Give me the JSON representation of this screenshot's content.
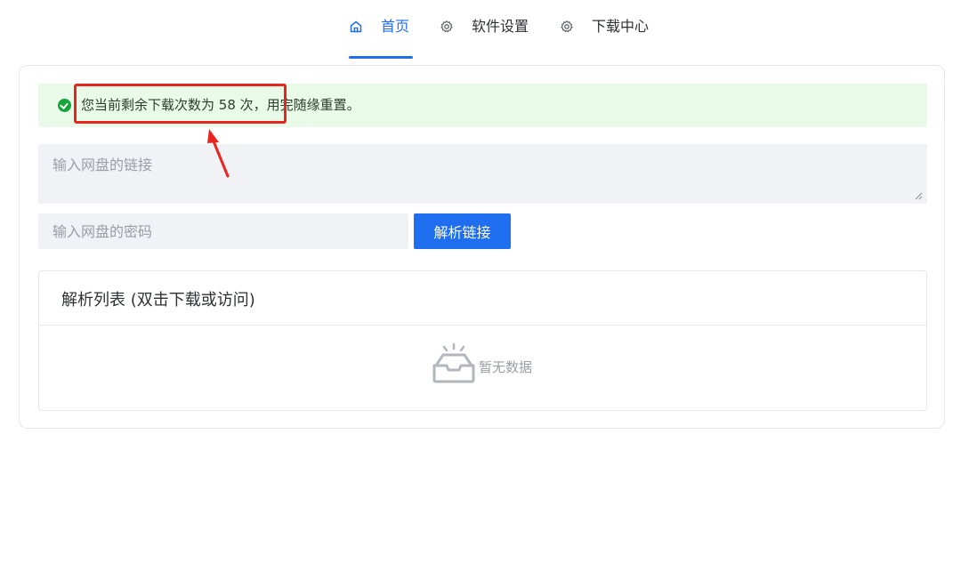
{
  "nav": {
    "items": [
      {
        "label": "首页",
        "icon": "home-icon",
        "active": true
      },
      {
        "label": "软件设置",
        "icon": "gear-icon",
        "active": false
      },
      {
        "label": "下载中心",
        "icon": "gear-icon",
        "active": false
      }
    ]
  },
  "alert": {
    "message": "您当前剩余下载次数为 58 次，用完随缘重置。",
    "type": "success"
  },
  "form": {
    "link_placeholder": "输入网盘的链接",
    "link_value": "",
    "password_placeholder": "输入网盘的密码",
    "password_value": "",
    "parse_button_label": "解析链接"
  },
  "list": {
    "title": "解析列表 (双击下载或访问)",
    "empty_text": "暂无数据"
  },
  "colors": {
    "accent": "#1f6ef0",
    "success_bg": "#e9fae8",
    "success_icon": "#13a538",
    "annotation": "#e8251f"
  }
}
